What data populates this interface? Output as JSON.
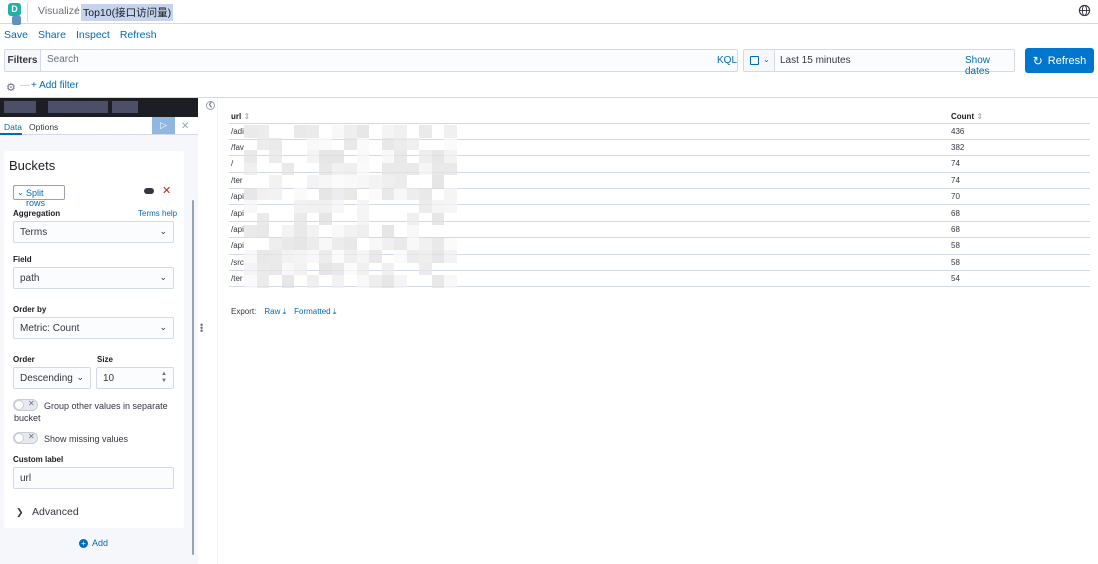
{
  "header": {
    "logo_letter": "D",
    "breadcrumb": [
      "Visualize",
      "Top10(接口访问量)"
    ],
    "separator": "/"
  },
  "menu": [
    "Save",
    "Share",
    "Inspect",
    "Refresh"
  ],
  "filterbar": {
    "label": "Filters",
    "search_placeholder": "Search",
    "language": "KQL"
  },
  "time": {
    "range": "Last 15 minutes",
    "show_dates": "Show dates",
    "refresh_label": "Refresh"
  },
  "add_filter": "+ Add filter",
  "sidebar": {
    "tabs": [
      "Data",
      "Options"
    ],
    "panel_title": "Buckets",
    "aggregation_item": "Split rows",
    "aggregation_label": "Aggregation",
    "terms_help": "Terms help",
    "aggregation_value": "Terms",
    "field_label": "Field",
    "field_value": "path",
    "order_by_label": "Order by",
    "order_by_value": "Metric: Count",
    "order_label": "Order",
    "order_value": "Descending",
    "size_label": "Size",
    "size_value": "10",
    "group_other_label": "Group other values in separate bucket",
    "show_missing_label": "Show missing values",
    "custom_label_label": "Custom label",
    "custom_label_value": "url",
    "advanced_label": "Advanced",
    "add_label": "Add"
  },
  "table": {
    "columns": [
      "url",
      "Count"
    ],
    "rows": [
      {
        "url": "/adi",
        "count": "436"
      },
      {
        "url": "/fav",
        "count": "382"
      },
      {
        "url": "/",
        "count": "74"
      },
      {
        "url": "/ter",
        "count": "74"
      },
      {
        "url": "/api",
        "count": "70"
      },
      {
        "url": "/api",
        "count": "68"
      },
      {
        "url": "/api",
        "count": "68"
      },
      {
        "url": "/api",
        "count": "58"
      },
      {
        "url": "/src",
        "count": "58"
      },
      {
        "url": "/ter",
        "count": "54"
      }
    ]
  },
  "export": {
    "label": "Export:",
    "raw": "Raw",
    "formatted": "Formatted"
  },
  "colors": {
    "accent": "#006bb8",
    "primary_button": "#0077cc",
    "danger": "#bd271e"
  }
}
